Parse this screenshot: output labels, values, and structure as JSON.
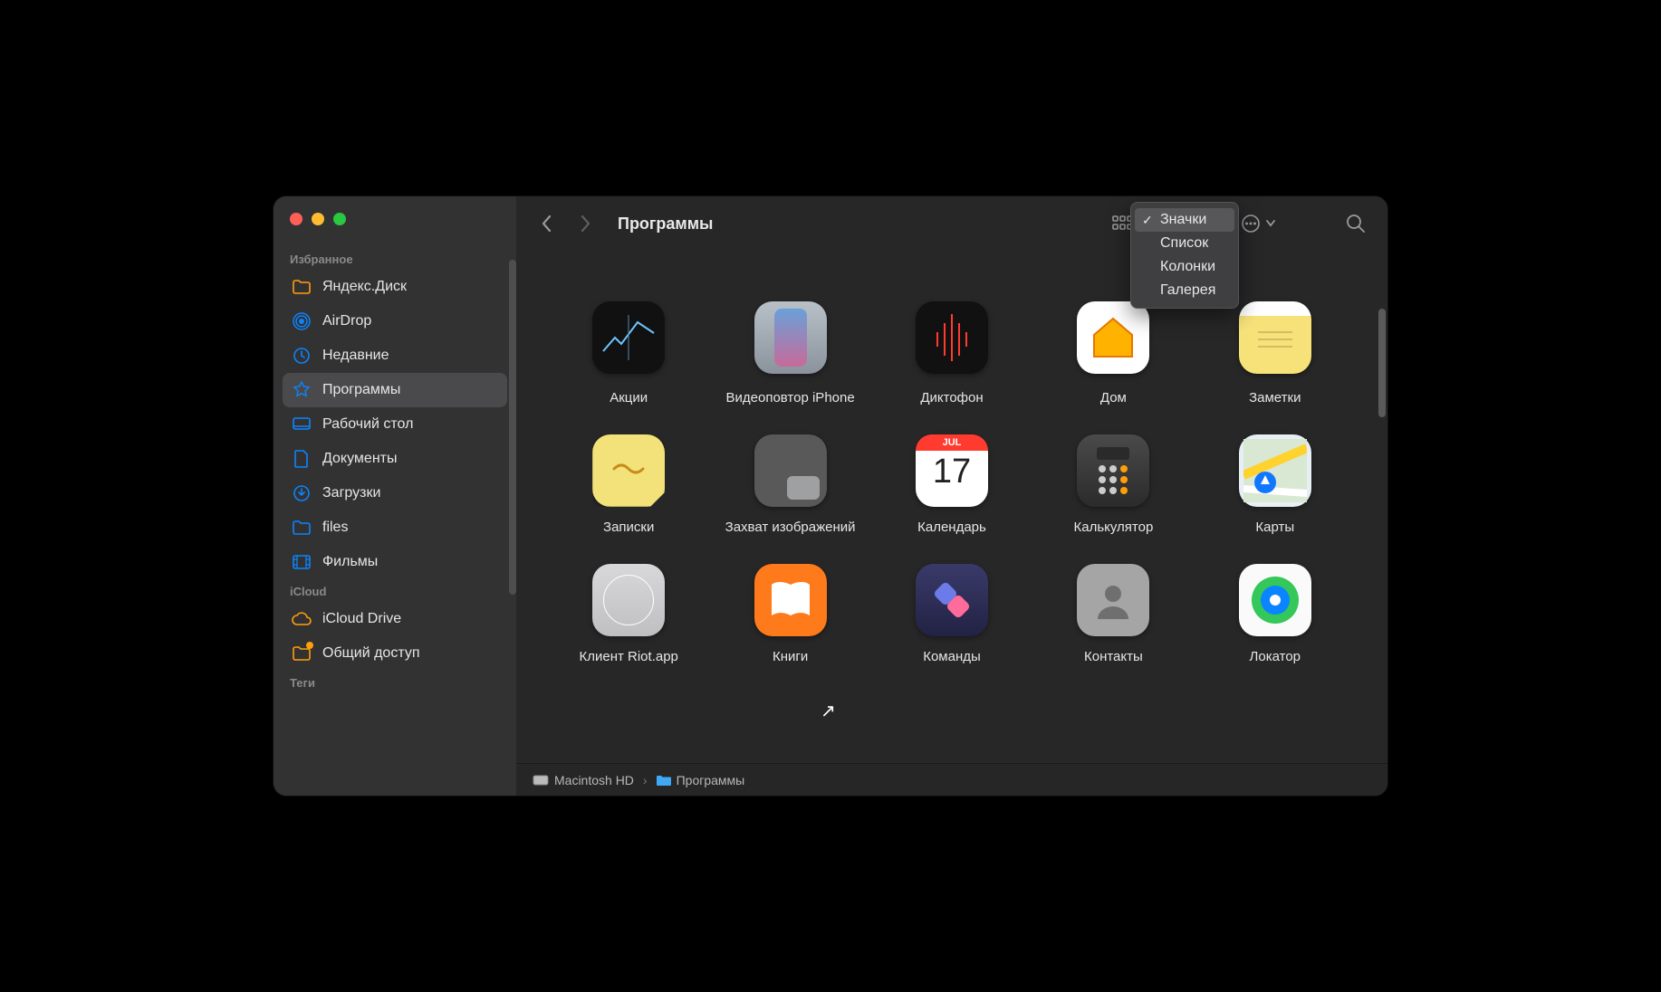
{
  "sidebar": {
    "sections": [
      {
        "label": "Избранное",
        "items": [
          {
            "id": "yandex-disk",
            "label": "Яндекс.Диск",
            "icon": "folder",
            "color": "orange"
          },
          {
            "id": "airdrop",
            "label": "AirDrop",
            "icon": "airdrop",
            "color": "blue"
          },
          {
            "id": "recent",
            "label": "Недавние",
            "icon": "clock",
            "color": "blue"
          },
          {
            "id": "applications",
            "label": "Программы",
            "icon": "apps",
            "color": "blue",
            "selected": true
          },
          {
            "id": "desktop",
            "label": "Рабочий стол",
            "icon": "desktop",
            "color": "blue"
          },
          {
            "id": "documents",
            "label": "Документы",
            "icon": "doc",
            "color": "blue"
          },
          {
            "id": "downloads",
            "label": "Загрузки",
            "icon": "download",
            "color": "blue"
          },
          {
            "id": "files",
            "label": "files",
            "icon": "folder",
            "color": "blue"
          },
          {
            "id": "movies",
            "label": "Фильмы",
            "icon": "film",
            "color": "blue"
          }
        ]
      },
      {
        "label": "iCloud",
        "items": [
          {
            "id": "icloud-drive",
            "label": "iCloud Drive",
            "icon": "cloud",
            "color": "orange"
          },
          {
            "id": "shared",
            "label": "Общий доступ",
            "icon": "folder",
            "color": "orange",
            "badge": true
          }
        ]
      },
      {
        "label": "Теги",
        "items": []
      }
    ]
  },
  "header": {
    "title": "Программы"
  },
  "view_menu": {
    "options": [
      {
        "label": "Значки",
        "checked": true,
        "selected": true
      },
      {
        "label": "Список",
        "checked": false,
        "selected": false
      },
      {
        "label": "Колонки",
        "checked": false,
        "selected": false
      },
      {
        "label": "Галерея",
        "checked": false,
        "selected": false
      }
    ]
  },
  "apps": [
    {
      "label": "Акции",
      "icon": "ic-stocks"
    },
    {
      "label": "Видеоповтор iPhone",
      "icon": "ic-iphone"
    },
    {
      "label": "Диктофон",
      "icon": "ic-voice"
    },
    {
      "label": "Дом",
      "icon": "ic-home"
    },
    {
      "label": "Заметки",
      "icon": "ic-notes"
    },
    {
      "label": "Записки",
      "icon": "ic-sticky"
    },
    {
      "label": "Захват изображений",
      "icon": "ic-capture"
    },
    {
      "label": "Календарь",
      "icon": "ic-cal"
    },
    {
      "label": "Калькулятор",
      "icon": "ic-calc"
    },
    {
      "label": "Карты",
      "icon": "ic-maps"
    },
    {
      "label": "Клиент Riot.app",
      "icon": "ic-riot"
    },
    {
      "label": "Книги",
      "icon": "ic-books"
    },
    {
      "label": "Команды",
      "icon": "ic-short"
    },
    {
      "label": "Контакты",
      "icon": "ic-contacts"
    },
    {
      "label": "Локатор",
      "icon": "ic-findmy"
    }
  ],
  "calendar_icon": {
    "month": "JUL",
    "day": "17"
  },
  "path": {
    "segments": [
      {
        "label": "Macintosh HD",
        "icon": "hdd"
      },
      {
        "label": "Программы",
        "icon": "folder"
      }
    ]
  }
}
